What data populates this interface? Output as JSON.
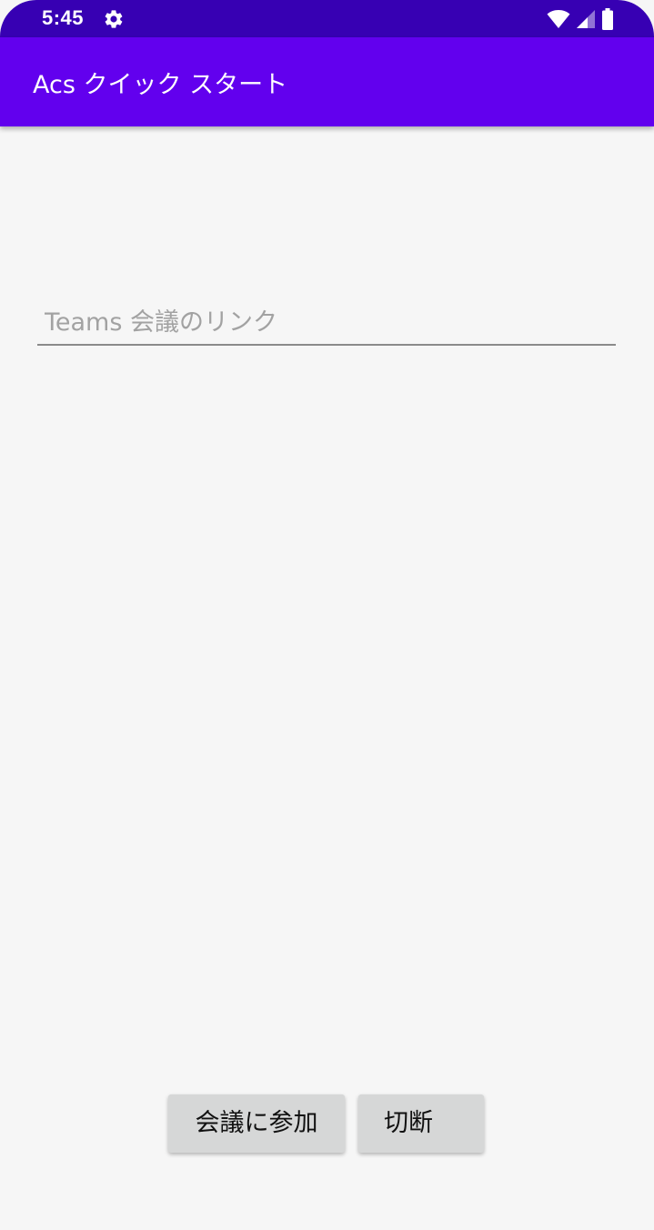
{
  "status_bar": {
    "time": "5:45",
    "icons": [
      "settings-gear-icon",
      "wifi-icon",
      "cellular-signal-icon",
      "battery-icon"
    ],
    "background": "#3700b3"
  },
  "app_bar": {
    "title": "Acs クイック スタート",
    "background": "#6200ee"
  },
  "meeting_link_input": {
    "placeholder": "Teams 会議のリンク",
    "value": ""
  },
  "buttons": {
    "join_label": "会議に参加",
    "hangup_label": "切断"
  }
}
